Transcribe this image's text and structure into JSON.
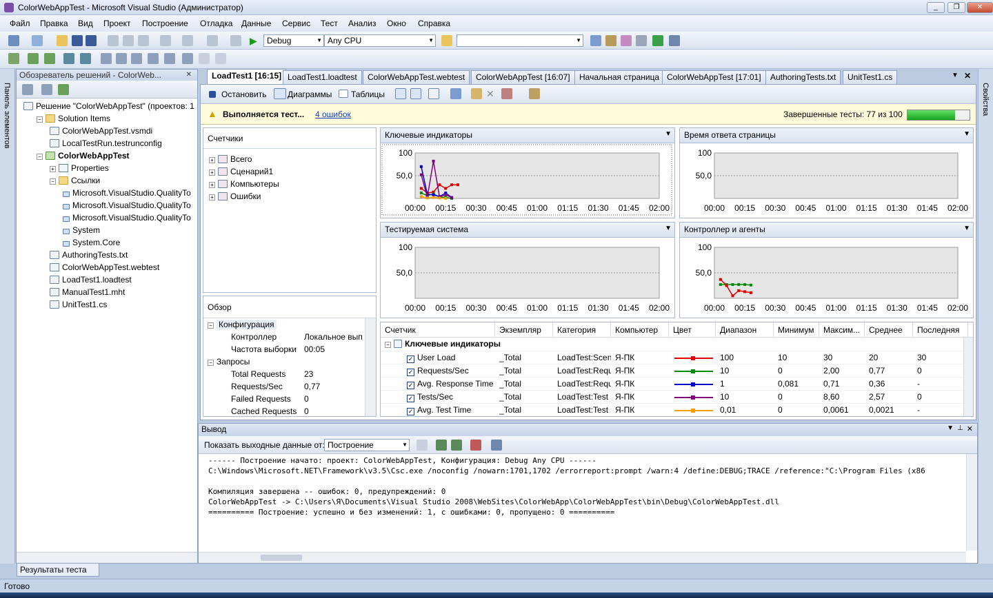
{
  "window": {
    "title": "ColorWebAppTest - Microsoft Visual Studio (Администратор)"
  },
  "menu": [
    "Файл",
    "Правка",
    "Вид",
    "Проект",
    "Построение",
    "Отладка",
    "Данные",
    "Сервис",
    "Тест",
    "Анализ",
    "Окно",
    "Справка"
  ],
  "toolbar": {
    "config": "Debug",
    "platform": "Any CPU",
    "find": ""
  },
  "left_strip": {
    "label": "Панель элементов"
  },
  "right_strip": {
    "label": "Свойства"
  },
  "solution": {
    "header": "Обозреватель решений - ColorWeb...",
    "tree": [
      {
        "label": "Решение \"ColorWebAppTest\"  (проектов: 1",
        "icon": "solution",
        "level": 0,
        "expander": "",
        "bold": false
      },
      {
        "label": "Solution Items",
        "icon": "folder",
        "level": 1,
        "expander": "−",
        "bold": false
      },
      {
        "label": "ColorWebAppTest.vsmdi",
        "icon": "file",
        "level": 2,
        "expander": "",
        "bold": false
      },
      {
        "label": "LocalTestRun.testrunconfig",
        "icon": "file",
        "level": 2,
        "expander": "",
        "bold": false
      },
      {
        "label": "ColorWebAppTest",
        "icon": "proj",
        "level": 1,
        "expander": "−",
        "bold": true
      },
      {
        "label": "Properties",
        "icon": "file",
        "level": 2,
        "expander": "+",
        "bold": false
      },
      {
        "label": "Ссылки",
        "icon": "folder",
        "level": 2,
        "expander": "−",
        "bold": false
      },
      {
        "label": "Microsoft.VisualStudio.QualityTo",
        "icon": "ref",
        "level": 3,
        "expander": "",
        "bold": false
      },
      {
        "label": "Microsoft.VisualStudio.QualityTo",
        "icon": "ref",
        "level": 3,
        "expander": "",
        "bold": false
      },
      {
        "label": "Microsoft.VisualStudio.QualityTo",
        "icon": "ref",
        "level": 3,
        "expander": "",
        "bold": false
      },
      {
        "label": "System",
        "icon": "ref",
        "level": 3,
        "expander": "",
        "bold": false
      },
      {
        "label": "System.Core",
        "icon": "ref",
        "level": 3,
        "expander": "",
        "bold": false
      },
      {
        "label": "AuthoringTests.txt",
        "icon": "file",
        "level": 2,
        "expander": "",
        "bold": false
      },
      {
        "label": "ColorWebAppTest.webtest",
        "icon": "file",
        "level": 2,
        "expander": "",
        "bold": false
      },
      {
        "label": "LoadTest1.loadtest",
        "icon": "file",
        "level": 2,
        "expander": "",
        "bold": false
      },
      {
        "label": "ManualTest1.mht",
        "icon": "file",
        "level": 2,
        "expander": "",
        "bold": false
      },
      {
        "label": "UnitTest1.cs",
        "icon": "file",
        "level": 2,
        "expander": "",
        "bold": false
      }
    ],
    "results_tab": "Результаты теста"
  },
  "doc_tabs": [
    "LoadTest1 [16:15]",
    "LoadTest1.loadtest",
    "ColorWebAppTest.webtest",
    "ColorWebAppTest [16:07]",
    "Начальная страница",
    "ColorWebAppTest [17:01]",
    "AuthoringTests.txt",
    "UnitTest1.cs"
  ],
  "loadtest": {
    "stop": "Остановить",
    "charts": "Диаграммы",
    "tables": "Таблицы",
    "status": "Выполняется тест...",
    "errors_link": "4 ошибок",
    "completed": "Завершенные тесты:  77 из 100",
    "progress": 0.77,
    "counters_title": "Счетчики",
    "counters": [
      "Всего",
      "Сценарий1",
      "Компьютеры",
      "Ошибки"
    ],
    "overview_title": "Обзор",
    "overview": [
      {
        "label": "Конфигурация",
        "value": "",
        "group": true,
        "hl": true
      },
      {
        "label": "Контроллер",
        "value": "Локальное вып",
        "group": false
      },
      {
        "label": "Частота выборки",
        "value": "00:05",
        "group": false
      },
      {
        "label": "Запросы",
        "value": "",
        "group": true
      },
      {
        "label": "Total Requests",
        "value": "23",
        "group": false
      },
      {
        "label": "Requests/Sec",
        "value": "0,77",
        "group": false
      },
      {
        "label": "Failed Requests",
        "value": "0",
        "group": false
      },
      {
        "label": "Cached Requests",
        "value": "0",
        "group": false
      }
    ]
  },
  "charts": [
    {
      "title": "Ключевые индикаторы"
    },
    {
      "title": "Время ответа страницы"
    },
    {
      "title": "Тестируемая система"
    },
    {
      "title": "Контроллер и агенты"
    }
  ],
  "chart_data": [
    {
      "type": "line",
      "title": "Ключевые индикаторы",
      "x": [
        "00:00",
        "00:15",
        "00:30",
        "00:45",
        "01:00",
        "01:15",
        "01:30",
        "01:45",
        "02:00"
      ],
      "y_ticks": [
        "100",
        "50,0"
      ],
      "ylim": [
        0,
        100
      ],
      "series": [
        {
          "color": "#e00000",
          "points": [
            [
              0.1,
              22
            ],
            [
              0.2,
              12
            ],
            [
              0.3,
              14
            ],
            [
              0.4,
              30
            ],
            [
              0.5,
              22
            ],
            [
              0.6,
              30
            ],
            [
              0.7,
              30
            ]
          ]
        },
        {
          "color": "#0a8a0a",
          "points": [
            [
              0.1,
              12
            ],
            [
              0.2,
              6
            ],
            [
              0.3,
              10
            ],
            [
              0.4,
              3
            ],
            [
              0.5,
              2
            ],
            [
              0.6,
              0
            ]
          ]
        },
        {
          "color": "#0000d0",
          "points": [
            [
              0.1,
              70
            ],
            [
              0.2,
              9
            ],
            [
              0.3,
              8
            ],
            [
              0.4,
              4
            ],
            [
              0.5,
              12
            ],
            [
              0.6,
              2
            ]
          ]
        },
        {
          "color": "#800080",
          "points": [
            [
              0.1,
              52
            ],
            [
              0.2,
              3
            ],
            [
              0.3,
              82
            ],
            [
              0.4,
              3
            ],
            [
              0.5,
              8
            ],
            [
              0.6,
              2
            ]
          ]
        },
        {
          "color": "#f0a000",
          "points": [
            [
              0.1,
              4
            ],
            [
              0.2,
              1
            ],
            [
              0.3,
              2
            ],
            [
              0.4,
              1
            ],
            [
              0.5,
              0
            ]
          ]
        }
      ]
    },
    {
      "type": "line",
      "title": "Время ответа страницы",
      "x": [
        "00:00",
        "00:15",
        "00:30",
        "00:45",
        "01:00",
        "01:15",
        "01:30",
        "01:45",
        "02:00"
      ],
      "y_ticks": [
        "100",
        "50,0"
      ],
      "ylim": [
        0,
        100
      ],
      "series": []
    },
    {
      "type": "line",
      "title": "Тестируемая система",
      "x": [
        "00:00",
        "00:15",
        "00:30",
        "00:45",
        "01:00",
        "01:15",
        "01:30",
        "01:45",
        "02:00"
      ],
      "y_ticks": [
        "100",
        "50,0"
      ],
      "ylim": [
        0,
        100
      ],
      "series": []
    },
    {
      "type": "line",
      "title": "Контроллер и агенты",
      "x": [
        "00:00",
        "00:15",
        "00:30",
        "00:45",
        "01:00",
        "01:15",
        "01:30",
        "01:45",
        "02:00"
      ],
      "y_ticks": [
        "100",
        "50,0"
      ],
      "ylim": [
        0,
        100
      ],
      "series": [
        {
          "color": "#0a8a0a",
          "points": [
            [
              0.1,
              27
            ],
            [
              0.2,
              27
            ],
            [
              0.3,
              27
            ],
            [
              0.4,
              27
            ],
            [
              0.5,
              27
            ],
            [
              0.6,
              26
            ]
          ]
        },
        {
          "color": "#e00000",
          "points": [
            [
              0.1,
              37
            ],
            [
              0.2,
              25
            ],
            [
              0.3,
              5
            ],
            [
              0.4,
              15
            ],
            [
              0.5,
              13
            ],
            [
              0.6,
              11
            ]
          ]
        }
      ]
    }
  ],
  "grid": {
    "columns": [
      "Счетчик",
      "Экземпляр",
      "Категория",
      "Компьютер",
      "Цвет",
      "Диапазон",
      "Минимум",
      "Максим...",
      "Среднее",
      "Последняя"
    ],
    "group": "Ключевые индикаторы",
    "rows": [
      {
        "counter": "User Load",
        "instance": "_Total",
        "category": "LoadTest:Scena",
        "computer": "Я-ПК",
        "color": "#e00000",
        "range": "100",
        "min": "10",
        "max": "30",
        "avg": "20",
        "last": "30"
      },
      {
        "counter": "Requests/Sec",
        "instance": "_Total",
        "category": "LoadTest:Requ",
        "computer": "Я-ПК",
        "color": "#0a8a0a",
        "range": "10",
        "min": "0",
        "max": "2,00",
        "avg": "0,77",
        "last": "0"
      },
      {
        "counter": "Avg. Response Time",
        "instance": "_Total",
        "category": "LoadTest:Requ",
        "computer": "Я-ПК",
        "color": "#0000d0",
        "range": "1",
        "min": "0,081",
        "max": "0,71",
        "avg": "0,36",
        "last": "-"
      },
      {
        "counter": "Tests/Sec",
        "instance": "_Total",
        "category": "LoadTest:Test",
        "computer": "Я-ПК",
        "color": "#800080",
        "range": "10",
        "min": "0",
        "max": "8,60",
        "avg": "2,57",
        "last": "0"
      },
      {
        "counter": "Avg. Test Time",
        "instance": "_Total",
        "category": "LoadTest:Test",
        "computer": "Я-ПК",
        "color": "#f0a000",
        "range": "0,01",
        "min": "0",
        "max": "0,0061",
        "avg": "0,0021",
        "last": "-"
      }
    ]
  },
  "output": {
    "title": "Вывод",
    "show_label": "Показать выходные данные от:",
    "source": "Построение",
    "lines": [
      "------ Построение начато: проект: ColorWebAppTest, Конфигурация: Debug Any CPU ------",
      "C:\\Windows\\Microsoft.NET\\Framework\\v3.5\\Csc.exe /noconfig /nowarn:1701,1702 /errorreport:prompt /warn:4 /define:DEBUG;TRACE /reference:\"C:\\Program Files (x86",
      "",
      "Компиляция завершена -- ошибок: 0, предупреждений: 0",
      "ColorWebAppTest -> C:\\Users\\Я\\Documents\\Visual Studio 2008\\WebSites\\ColorWebApp\\ColorWebAppTest\\bin\\Debug\\ColorWebAppTest.dll",
      "========== Построение: успешно и без изменений: 1, с ошибками: 0, пропущено: 0 =========="
    ]
  },
  "status": "Готово"
}
